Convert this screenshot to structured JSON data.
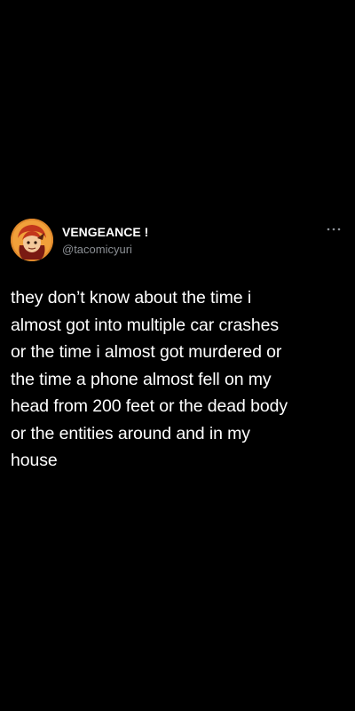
{
  "tweet": {
    "display_name": "VENGEANCE !",
    "handle": "@tacomicyuri",
    "text": "they don’t know about the time i\nalmost got into multiple car crashes\nor the time i almost got murdered or\nthe time a phone almost fell on my\nhead from 200 feet or the dead body\nor the entities around and in my\nhouse",
    "avatar_icon": "cartoon-character-avatar",
    "more_icon": "more-options-icon"
  },
  "colors": {
    "background": "#000000",
    "primary_text": "#ffffff",
    "secondary_text": "#8b8f94",
    "avatar_bg": "#e08a2a"
  }
}
